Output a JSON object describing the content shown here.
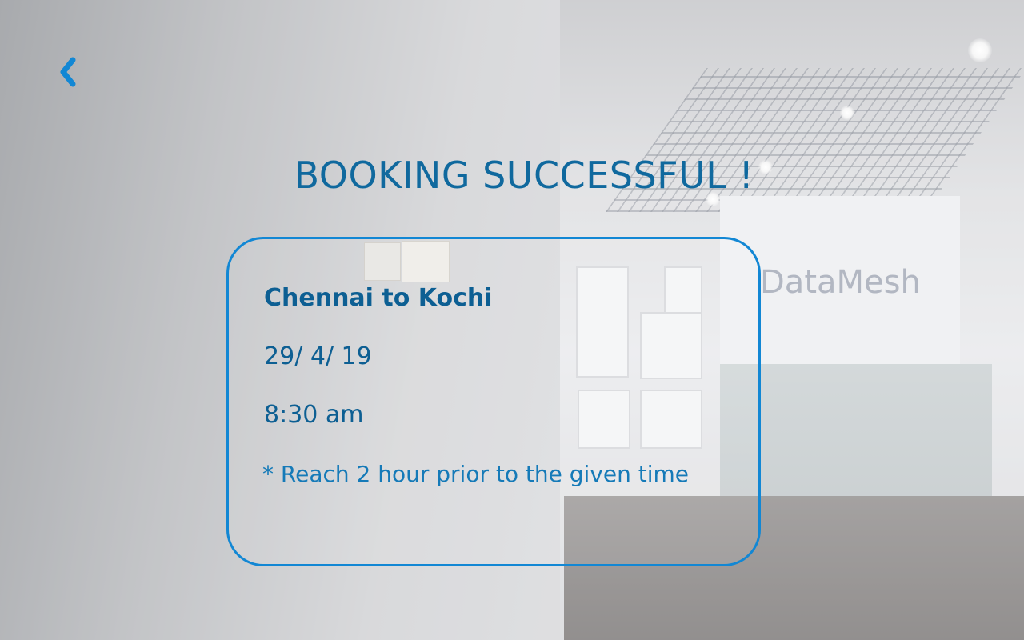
{
  "header": {
    "back_icon": "chevron-left-icon",
    "title": "BOOKING SUCCESSFUL !"
  },
  "booking": {
    "route": "Chennai to Kochi",
    "date": "29/ 4/ 19",
    "time": "8:30 am",
    "note": "* Reach 2 hour prior to the given time"
  },
  "background": {
    "description_sign": "DataMesh"
  },
  "colors": {
    "accent": "#1287d4",
    "text_primary": "#0d5f93",
    "title": "#10699e"
  }
}
